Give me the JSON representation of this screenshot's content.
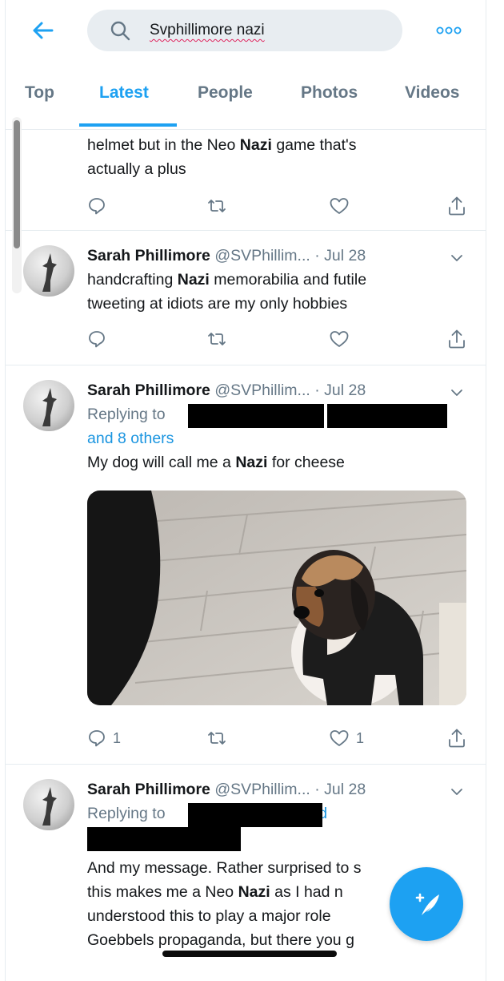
{
  "search": {
    "query": "Svphillimore nazi"
  },
  "tabs": [
    "Top",
    "Latest",
    "People",
    "Photos",
    "Videos"
  ],
  "active_tab": "Latest",
  "tweet1": {
    "line1_a": "helmet but in the Neo ",
    "line1_b": "Nazi",
    "line1_c": " game that's",
    "line2": "actually a plus"
  },
  "tweet2": {
    "name": "Sarah Phillimore",
    "handle": "@SVPhillim...",
    "sep": "·",
    "date": "Jul 28",
    "line1_a": "handcrafting ",
    "line1_b": "Nazi",
    "line1_c": " memorabilia and futile",
    "line2": "tweeting at idiots are my only hobbies"
  },
  "tweet3": {
    "name": "Sarah Phillimore",
    "handle": "@SVPhillim...",
    "sep": "·",
    "date": "Jul 28",
    "replying": "Replying to",
    "others": "and 8 others",
    "text_a": "My dog will call me a ",
    "text_b": "Nazi",
    "text_c": " for cheese",
    "reply_count": "1",
    "like_count": "1"
  },
  "tweet4": {
    "name": "Sarah Phillimore",
    "handle": "@SVPhillim...",
    "sep": "·",
    "date": "Jul 28",
    "replying": "Replying to",
    "and": "and",
    "line1": "And my message. Rather surprised to s",
    "line2_a": "this makes me a Neo ",
    "line2_b": "Nazi",
    "line2_c": " as I had n",
    "line3": "understood this to play a major role",
    "line4": "Goebbels propaganda, but there you g"
  },
  "colors": {
    "accent": "#1da1f2",
    "muted": "#657786",
    "border": "#e6ecf0"
  }
}
